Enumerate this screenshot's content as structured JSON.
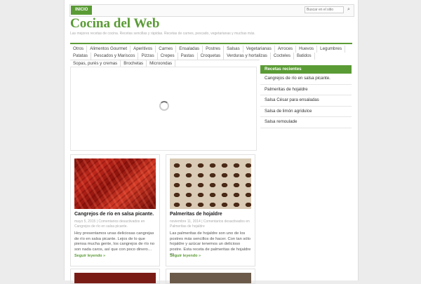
{
  "topbar": {
    "home": "INICIO",
    "search_placeholder": "Buscar en el sitio"
  },
  "site": {
    "title": "Cocina del Web",
    "description": "Las mejores recetas de cocina. Recetas sencillas y rápidas. Recetas de carnes, pescado, vegetarianas y muchas más."
  },
  "menu": {
    "row1": [
      "Otros",
      "Alimentos Gourmet",
      "Aperitivos",
      "Carnes",
      "Ensaladas",
      "Postres",
      "Salsas",
      "Vegetarianas",
      "Arroces",
      "Huevos",
      "Legumbres"
    ],
    "row2": [
      "Patatas",
      "Pescados y Mariscos",
      "Pizzas",
      "Crepes",
      "Pastas",
      "Croquetas",
      "Verduras y hortalizas",
      "Cocteles",
      "Batidos"
    ],
    "row3": [
      "Sopas, purés y cremas",
      "Brochetas",
      "Microondas"
    ]
  },
  "posts": [
    {
      "title": "Cangrejos de río en salsa picante.",
      "date": "mayo 5, 2015",
      "comments": "Comentarios desactivados en Cangrejos de río en salsa picante.",
      "excerpt": "Hoy presentamos unas deliciosas cangrejas de río en salsa picante. Lejos de lo que piensa mucha gente, los cangrejos de río no son nada caros, así que con poco dinero…",
      "more": "Seguir leyendo »"
    },
    {
      "title": "Palmeritas de hojaldre",
      "date": "noviembre 11, 2014",
      "comments": "Comentarios desactivados en Palmeritas de hojaldre",
      "excerpt": "Las palmeritas de hojaldre son uno de los postres más sencillos de hacer. Con tan sólo hojaldre y azúcar tenemos un delicioso postre. Esta receta de palmeritas de hojaldre es…",
      "more": "Seguir leyendo »"
    }
  ],
  "sidebar": {
    "title": "Recetas recientes",
    "items": [
      "Cangrejos de río en salsa picante.",
      "Palmeritas de hojaldre",
      "Salsa César para ensaladas",
      "Salsa de limón agridulce",
      "Salsa remoulade"
    ]
  },
  "colors": {
    "accent": "#5a9b35"
  }
}
